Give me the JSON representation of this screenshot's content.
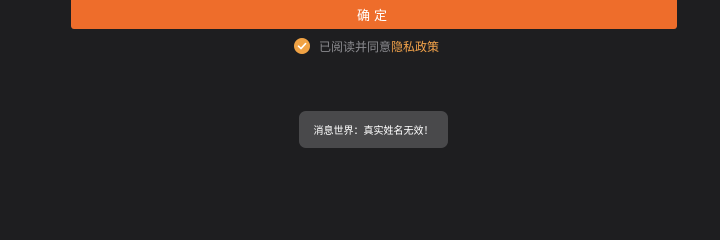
{
  "form": {
    "confirm_label": "确定"
  },
  "agreement": {
    "checked": true,
    "text": "已阅读并同意",
    "link_label": "隐私政策"
  },
  "toast": {
    "message": "消息世界：真实姓名无效！"
  },
  "colors": {
    "background": "#1e1e20",
    "accent": "#ee6d2b",
    "check": "#f0a244",
    "link": "#f3a34a",
    "toast_bg": "#49494b"
  },
  "icons": {
    "check": "check-circle-icon"
  }
}
